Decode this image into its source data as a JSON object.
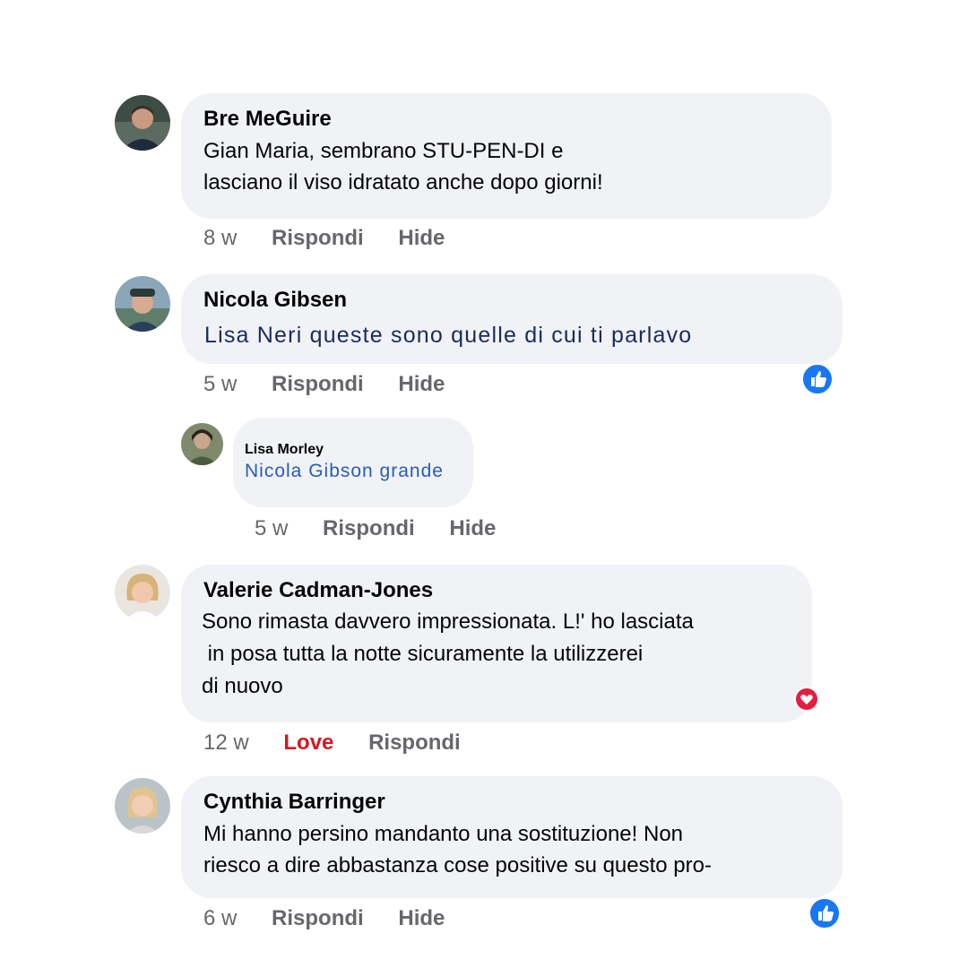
{
  "comments": [
    {
      "author": "Bre MeGuire",
      "lines": [
        "Gian Maria, sembrano STU-PEN-DI e",
        "lasciano il viso idratato anche dopo giorni!"
      ],
      "time": "8 w",
      "actions": [
        "Rispondi",
        "Hide"
      ],
      "avatar_icon": "person-avatar"
    },
    {
      "author": "Nicola Gibsen",
      "lines": [
        "Lisa Neri queste sono quelle di cui ti parlavo"
      ],
      "time": "5 w",
      "actions": [
        "Rispondi",
        "Hide"
      ],
      "reaction_icon": "like-icon",
      "reaction_color": "#1877f2",
      "avatar_icon": "person-avatar",
      "reply": {
        "author": "Lisa Morley",
        "lines": [
          "Nicola Gibson grande"
        ],
        "time": "5 w",
        "actions": [
          "Rispondi",
          "Hide"
        ],
        "avatar_icon": "person-avatar"
      }
    },
    {
      "author": "Valerie Cadman-Jones",
      "lines": [
        "Sono rimasta davvero impressionata. L!' ho lasciata",
        " in posa tutta la notte sicuramente la utilizzerei",
        "di nuovo"
      ],
      "time": "12 w",
      "actions": [
        "Love",
        "Rispondi"
      ],
      "reaction_icon": "love-icon",
      "reaction_color": "#e41e3f",
      "avatar_icon": "person-avatar"
    },
    {
      "author": "Cynthia Barringer",
      "lines": [
        "Mi hanno persino mandanto una sostituzione! Non",
        "riesco a dire abbastanza cose positive su questo pro-"
      ],
      "time": "6 w",
      "actions": [
        "Rispondi",
        "Hide"
      ],
      "reaction_icon": "like-icon",
      "reaction_color": "#1877f2",
      "avatar_icon": "person-avatar"
    }
  ]
}
